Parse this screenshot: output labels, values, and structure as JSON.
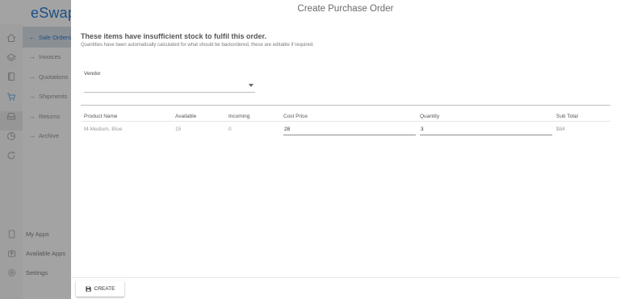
{
  "sidebar": {
    "brand": "eSwap",
    "nav_items": [
      {
        "label": "Sale Orders",
        "arrow": "←",
        "active": true
      },
      {
        "label": "Invoices",
        "arrow": "→"
      },
      {
        "label": "Quotations",
        "arrow": "→"
      },
      {
        "label": "Shipments",
        "arrow": "→"
      },
      {
        "label": "Returns",
        "arrow": "→"
      },
      {
        "label": "Archive",
        "arrow": "→"
      }
    ],
    "bottom_items": [
      {
        "label": "My Apps",
        "icon": "tablet-icon"
      },
      {
        "label": "Available Apps",
        "icon": "download-icon"
      },
      {
        "label": "Settings",
        "icon": "gear-icon"
      }
    ]
  },
  "dialog": {
    "title": "Create Purchase Order",
    "heading": "These items have insufficient stock to fulfil this order.",
    "subheading": "Quantities have been automatically calculated for what should be backordered, these are editable if required.",
    "vendor": {
      "label": "Vendor",
      "value": ""
    },
    "table": {
      "columns": [
        "Product Name",
        "Available",
        "Incoming",
        "Cost Price",
        "Quantity",
        "Sub Total"
      ],
      "rows": [
        {
          "product": "M-Medium, Blue",
          "available": "15",
          "incoming": "0",
          "cost_price": "28",
          "quantity": "3",
          "subtotal": "$84"
        }
      ]
    },
    "create_label": "CREATE"
  },
  "colors": {
    "brand": "#1b4f86",
    "overlay": "#a3a3a3"
  }
}
